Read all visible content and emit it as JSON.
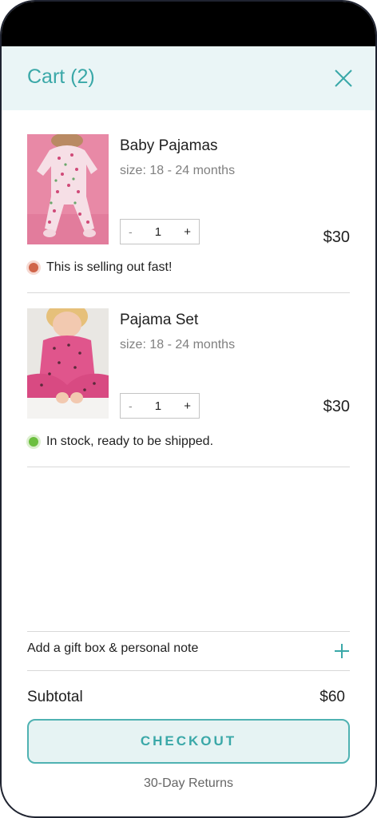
{
  "header": {
    "title": "Cart (2)"
  },
  "items": [
    {
      "name": "Baby Pajamas",
      "size": "size: 18 - 24 months",
      "qty_dec": "-",
      "qty": "1",
      "qty_inc": "+",
      "price": "$30",
      "status": "This is selling out fast!",
      "status_color": "#d0654a"
    },
    {
      "name": "Pajama Set",
      "size": "size: 18 - 24 months",
      "qty_dec": "-",
      "qty": "1",
      "qty_inc": "+",
      "price": "$30",
      "status": "In stock, ready to be shipped.",
      "status_color": "#6cbf3f"
    }
  ],
  "gift": {
    "label": "Add a gift box & personal note"
  },
  "summary": {
    "subtotal_label": "Subtotal",
    "subtotal_value": "$60"
  },
  "checkout": {
    "label": "CHECKOUT"
  },
  "footer": {
    "returns": "30-Day Returns"
  },
  "colors": {
    "accent": "#3aa8a8",
    "header_bg": "#eaf5f6"
  }
}
